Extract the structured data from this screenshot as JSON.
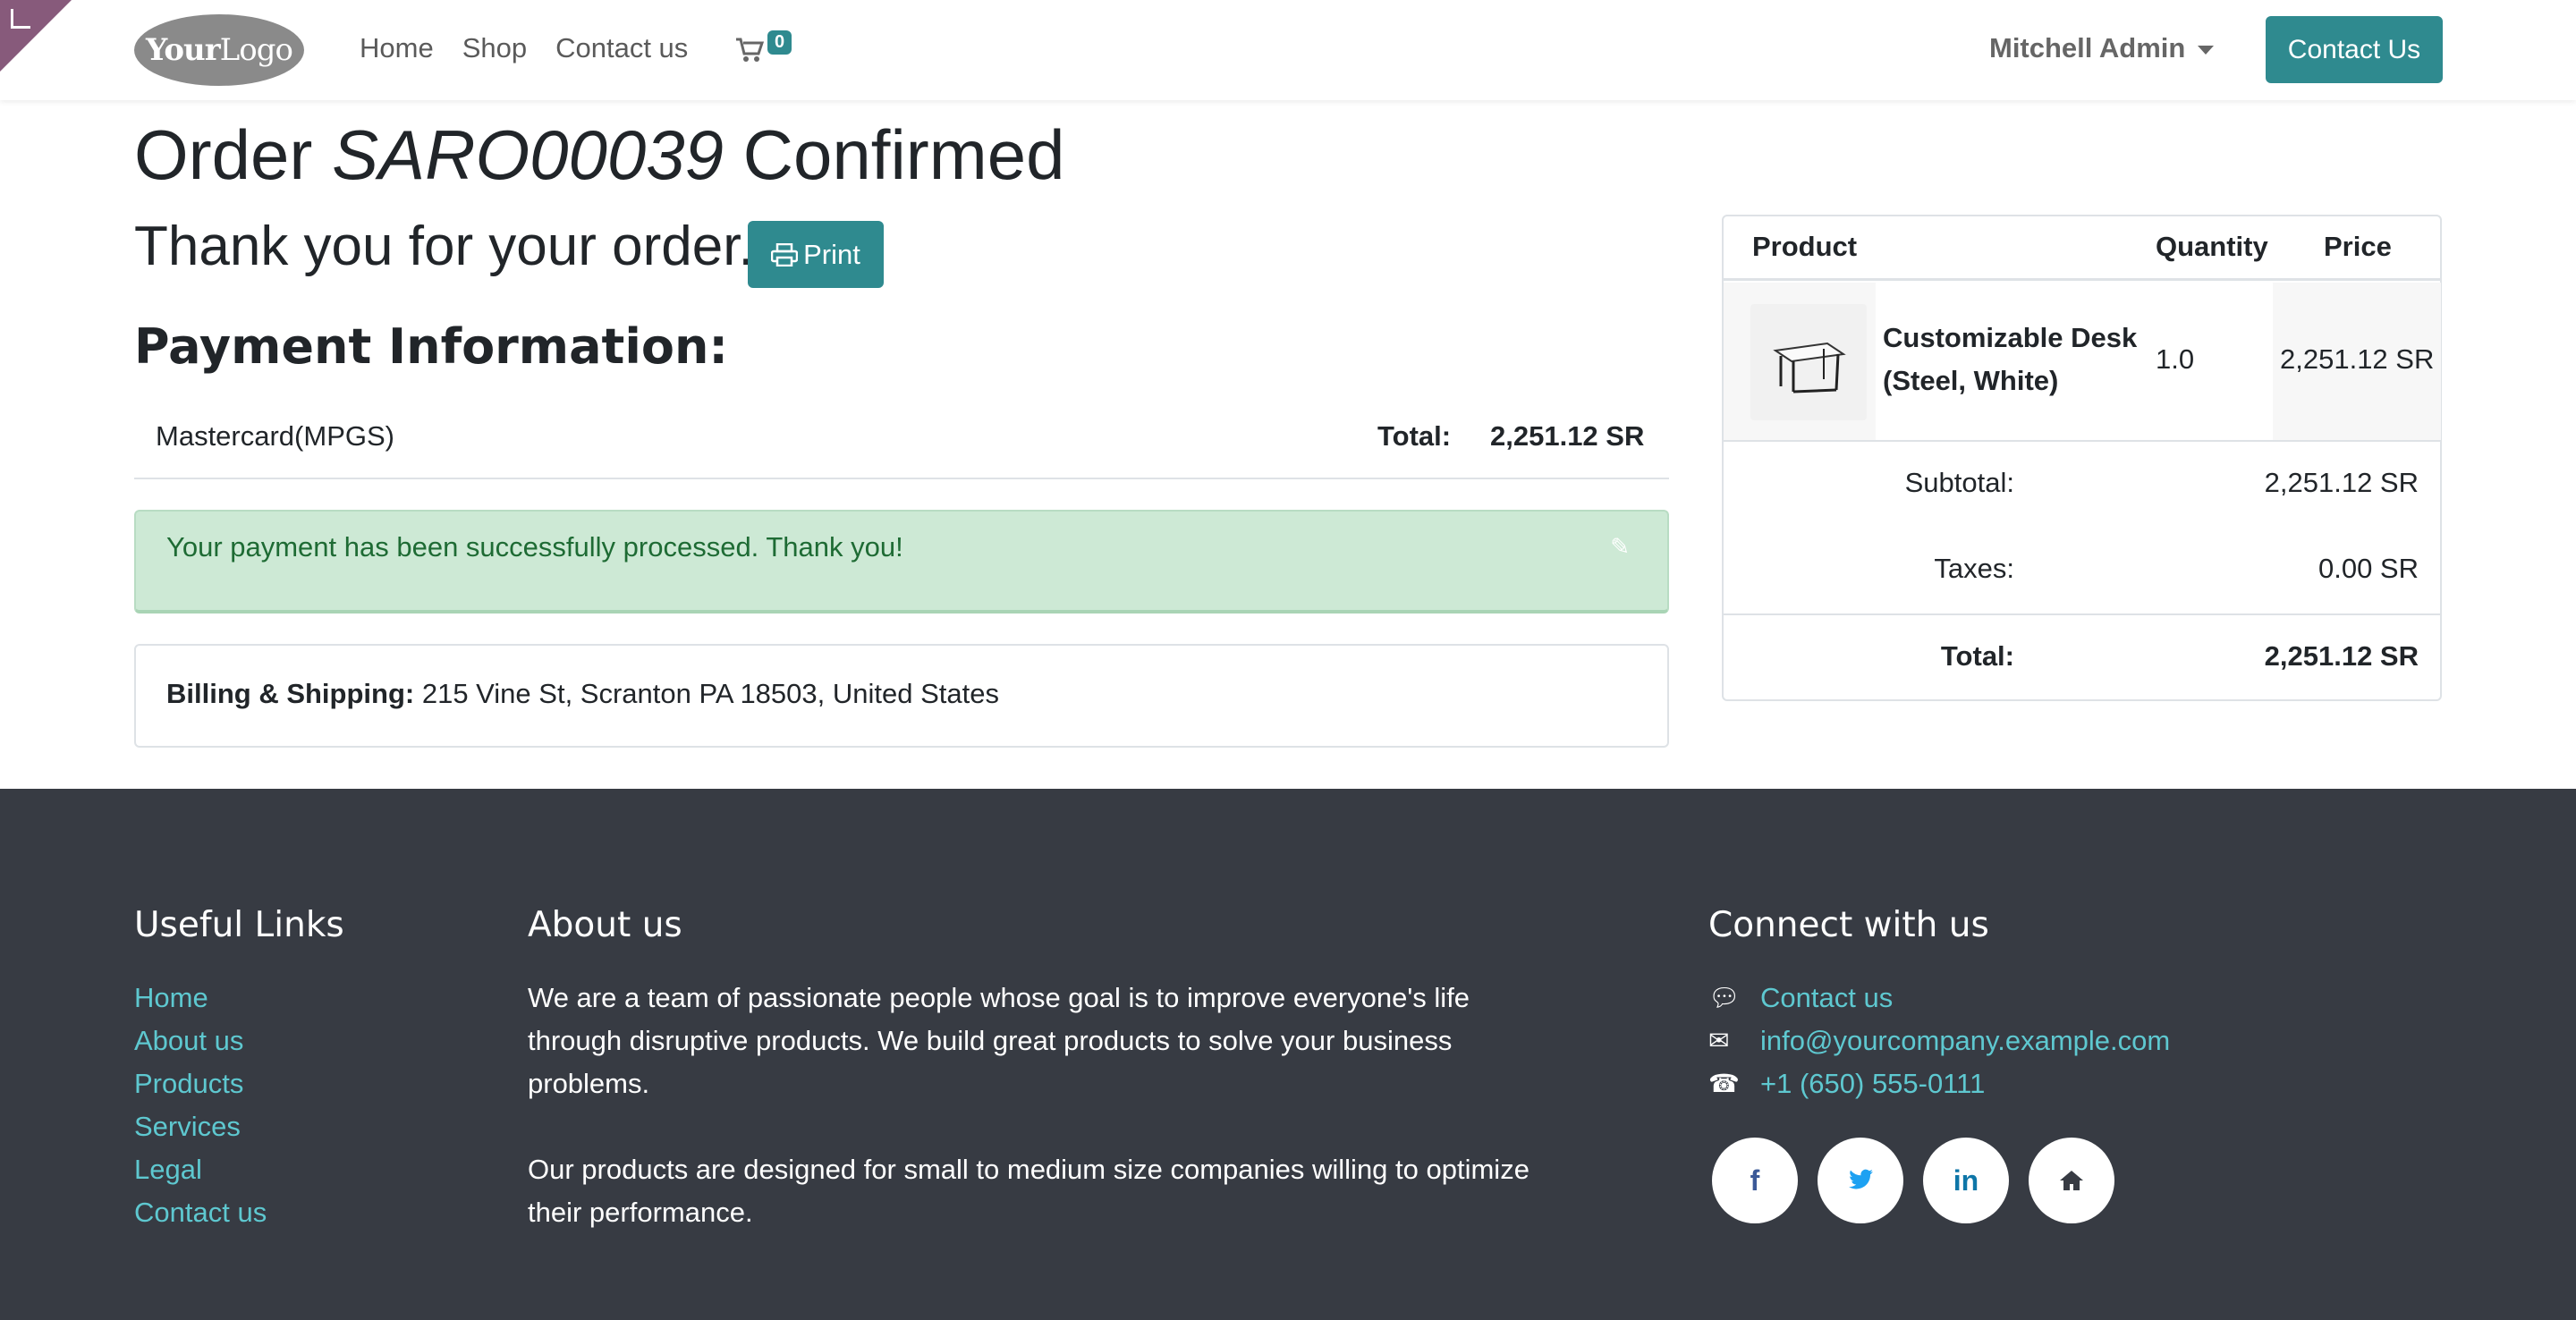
{
  "header": {
    "logo_text_bold": "Your",
    "logo_text_light": "Logo",
    "nav": [
      "Home",
      "Shop",
      "Contact us"
    ],
    "cart_count": "0",
    "user_name": "Mitchell Admin",
    "contact_button": "Contact Us"
  },
  "order": {
    "title_prefix": "Order ",
    "order_number": "SARO00039",
    "title_suffix": " Confirmed",
    "thanks": "Thank you for your order.",
    "print_label": "Print"
  },
  "payment": {
    "heading": "Payment Information:",
    "method": "Mastercard(MPGS)",
    "total_label": "Total:",
    "total_value": "2,251.12 SR",
    "alert": "Your payment has been successfully processed. Thank you!"
  },
  "billing": {
    "label": "Billing & Shipping:",
    "address": " 215 Vine St, Scranton PA 18503, United States"
  },
  "summary": {
    "headers": {
      "product": "Product",
      "quantity": "Quantity",
      "price": "Price"
    },
    "lines": [
      {
        "name": "Customizable Desk (Steel, White)",
        "quantity": "1.0",
        "price": "2,251.12 SR"
      }
    ],
    "subtotal_label": "Subtotal:",
    "subtotal_value": "2,251.12 SR",
    "taxes_label": "Taxes:",
    "taxes_value": "0.00 SR",
    "total_label": "Total:",
    "total_value": "2,251.12 SR"
  },
  "footer": {
    "useful_links_heading": "Useful Links",
    "useful_links": [
      "Home",
      "About us",
      "Products",
      "Services",
      "Legal",
      "Contact us"
    ],
    "about_heading": "About us",
    "about_p1": "We are a team of passionate people whose goal is to improve everyone's life through disruptive products. We build great products to solve your business problems.",
    "about_p2": "Our products are designed for small to medium size companies willing to optimize their performance.",
    "connect_heading": "Connect with us",
    "connect_contact": "Contact us",
    "connect_email": "info@yourcompany.example.com",
    "connect_phone": "+1 (650) 555-0111",
    "socials": [
      "facebook-icon",
      "twitter-icon",
      "linkedin-icon",
      "home-icon"
    ]
  },
  "colors": {
    "accent": "#2f8a8f",
    "link": "#5ec8d0",
    "footer_bg": "#373b43",
    "alert_bg": "#cde9d5"
  }
}
